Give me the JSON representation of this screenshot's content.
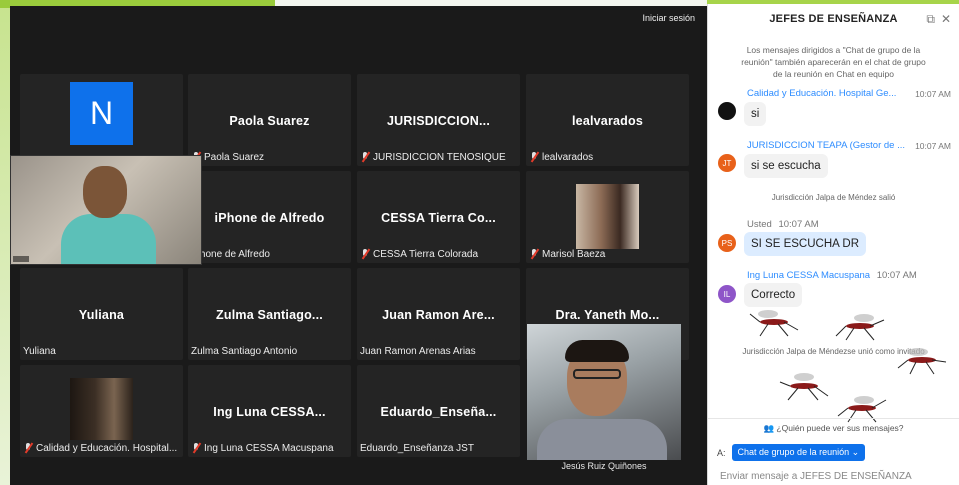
{
  "meeting": {
    "signin_label": "Iniciar sesión",
    "tiles": [
      {
        "name": "",
        "label": "",
        "muted": false,
        "avatar_letter": "N"
      },
      {
        "name": "Paola Suarez",
        "label": "Paola Suarez",
        "muted": true
      },
      {
        "name": "JURISDICCION...",
        "label": "JURISDICCION TENOSIQUE",
        "muted": true
      },
      {
        "name": "lealvarados",
        "label": "lealvarados",
        "muted": true
      },
      {
        "name": "iPhone de Alfredo",
        "label": "iPhone de Alfredo",
        "muted": false
      },
      {
        "name": "CESSA Tierra Co...",
        "label": "CESSA Tierra Colorada",
        "muted": true
      },
      {
        "name": "",
        "label": "Marisol Baeza",
        "muted": true
      },
      {
        "name": "Yuliana",
        "label": "Yuliana",
        "muted": false
      },
      {
        "name": "Zulma Santiago...",
        "label": "Zulma Santiago Antonio",
        "muted": false
      },
      {
        "name": "Juan Ramon Are...",
        "label": "Juan Ramon Arenas Arias",
        "muted": false
      },
      {
        "name": "Dra. Yaneth Mo...",
        "label": "",
        "muted": false
      },
      {
        "name": "",
        "label": "Calidad y Educación. Hospital...",
        "muted": true
      },
      {
        "name": "Ing Luna CESSA...",
        "label": "Ing Luna CESSA Macuspana",
        "muted": true
      },
      {
        "name": "Eduardo_Enseña...",
        "label": "Eduardo_Enseñanza JST",
        "muted": false
      }
    ],
    "pinned_video_name": "Jesús Ruiz Quiñones"
  },
  "chat": {
    "title": "JEFES DE ENSEÑANZA",
    "notice": "Los mensajes dirigidos a \"Chat de grupo de la reunión\" también aparecerán en el chat de grupo de la reunión en Chat en equipo",
    "messages": [
      {
        "sender": "Calidad y Educación. Hospital Ge...",
        "time": "10:07 AM",
        "text": "si",
        "avatar": "",
        "avatar_color": "#111111"
      },
      {
        "sender": "JURISDICCION TEAPA (Gestor de ...",
        "time": "10:07 AM",
        "text": "si se escucha",
        "avatar": "JT",
        "avatar_color": "#e8611a"
      },
      {
        "sender": "Usted",
        "time": "10:07 AM",
        "text": "SI SE ESCUCHA DR",
        "avatar": "PS",
        "avatar_color": "#e8611a"
      },
      {
        "sender": "Ing Luna CESSA Macuspana",
        "time": "10:07 AM",
        "text": "Correcto",
        "avatar": "IL",
        "avatar_color": "#8e55c8"
      }
    ],
    "system_left": "Jurisdicción Jalpa de Méndez salió",
    "system_joined": "Jurisdicción Jalpa de Méndezse unió como invitado",
    "who_can_see": "¿Quién puede ver sus mensajes?",
    "to_label": "A:",
    "to_value": "Chat de grupo de la reunión",
    "input_placeholder": "Enviar mensaje a JEFES DE ENSEÑANZA"
  },
  "colors": {
    "accent": "#0e71eb",
    "link": "#2d8cff",
    "muted_mic": "#e23b2a"
  }
}
